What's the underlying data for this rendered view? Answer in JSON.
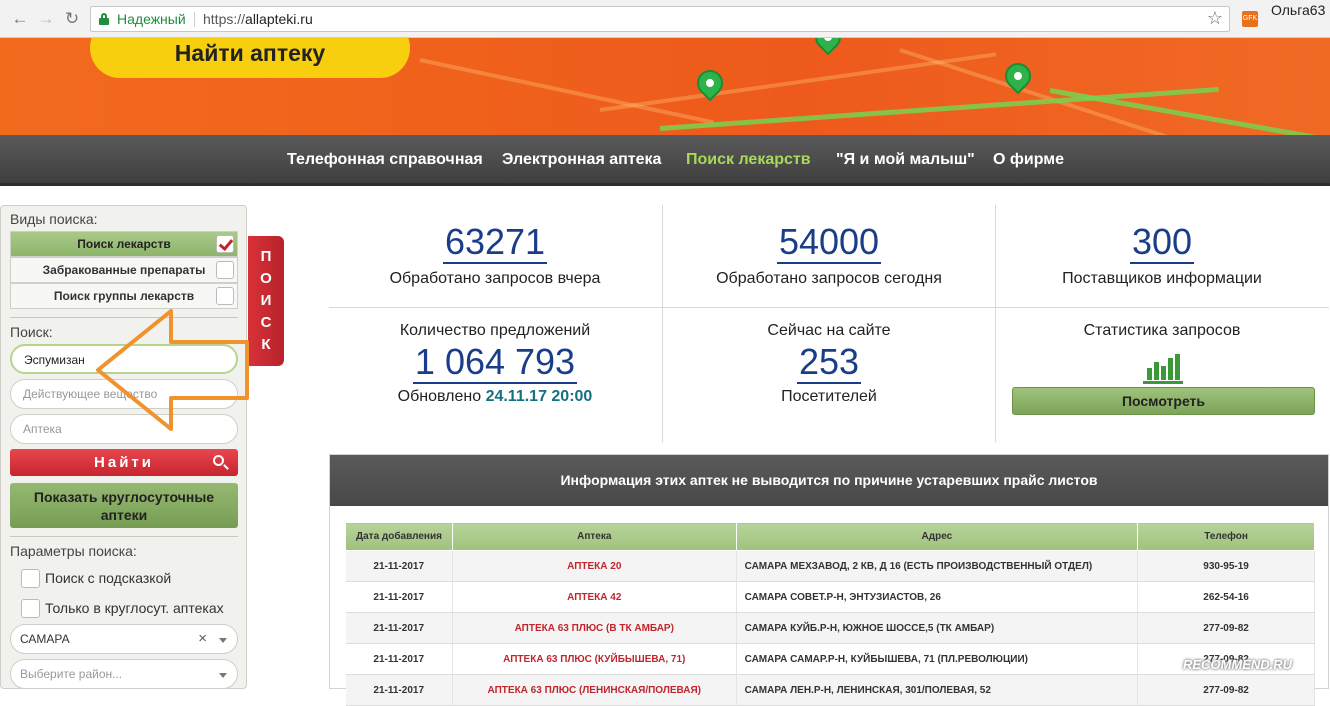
{
  "browser": {
    "secure_label": "Надежный",
    "url_scheme": "https://",
    "url_host": "allapteki.ru",
    "user": "Ольга63",
    "ext_label": "GFK"
  },
  "banner": {
    "find_label": "Найти аптеку"
  },
  "nav": {
    "items": [
      "Телефонная справочная",
      "Электронная аптека",
      "Поиск лекарств",
      "\"Я и мой малыш\"",
      "О фирме"
    ],
    "active_index": 2
  },
  "sidebar": {
    "types_label": "Виды поиска:",
    "types": [
      {
        "label": "Поиск лекарств",
        "checked": true
      },
      {
        "label": "Забракованные препараты",
        "checked": false
      },
      {
        "label": "Поиск группы лекарств",
        "checked": false
      }
    ],
    "search_label": "Поиск:",
    "search_value": "Эспумизан",
    "substance_placeholder": "Действующее вещество",
    "pharmacy_placeholder": "Аптека",
    "find_button": "Найти",
    "allnight_button_line1": "Показать круглосуточные",
    "allnight_button_line2": "аптеки",
    "params_label": "Параметры поиска:",
    "opt_hint": "Поиск с подсказкой",
    "opt_allnight": "Только в круглосут. аптеках",
    "city_value": "САМАРА",
    "district_placeholder": "Выберите район..."
  },
  "vertical_tab": [
    "П",
    "О",
    "И",
    "С",
    "К"
  ],
  "stats": {
    "yesterday_value": "63271",
    "yesterday_desc": "Обработано запросов вчера",
    "today_value": "54000",
    "today_desc": "Обработано запросов сегодня",
    "suppliers_value": "300",
    "suppliers_desc": "Поставщиков информации",
    "offers_title": "Количество предложений",
    "offers_value": "1 064 793",
    "updated_label": "Обновлено",
    "updated_value": "24.11.17 20:00",
    "online_title": "Сейчас на сайте",
    "online_value": "253",
    "online_desc": "Посетителей",
    "requests_title": "Статистика запросов",
    "view_button": "Посмотреть"
  },
  "info": {
    "header": "Информация этих аптек не выводится по причине устаревших прайс листов",
    "columns": [
      "Дата добавления",
      "Аптека",
      "Адрес",
      "Телефон"
    ],
    "rows": [
      [
        "21-11-2017",
        "АПТЕКА 20",
        "САМАРА МЕХЗАВОД, 2 КВ, Д 16 (ЕСТЬ ПРОИЗВОДСТВЕННЫЙ ОТДЕЛ)",
        "930-95-19"
      ],
      [
        "21-11-2017",
        "АПТЕКА 42",
        "САМАРА СОВЕТ.Р-Н, ЭНТУЗИАСТОВ, 26",
        "262-54-16"
      ],
      [
        "21-11-2017",
        "АПТЕКА 63 ПЛЮС (В ТК АМБАР)",
        "САМАРА КУЙБ.Р-Н, ЮЖНОЕ ШОССЕ,5 (ТК АМБАР)",
        "277-09-82"
      ],
      [
        "21-11-2017",
        "АПТЕКА 63 ПЛЮС (КУЙБЫШЕВА, 71)",
        "САМАРА САМАР.Р-Н, КУЙБЫШЕВА, 71 (ПЛ.РЕВОЛЮЦИИ)",
        "277-09-82"
      ],
      [
        "21-11-2017",
        "АПТЕКА 63 ПЛЮС (ЛЕНИНСКАЯ/ПОЛЕВАЯ)",
        "САМАРА ЛЕН.Р-Н, ЛЕНИНСКАЯ, 301/ПОЛЕВАЯ, 52",
        "277-09-82"
      ]
    ]
  },
  "watermark": "RECOMMEND.RU",
  "colors": {
    "banner_orange": "#f26b1d",
    "find_yellow": "#f7cf0f",
    "nav_active_green": "#a8d85a",
    "stat_blue": "#1a3d8a",
    "search_red": "#c6252d",
    "arrow_orange": "#f0932f"
  }
}
